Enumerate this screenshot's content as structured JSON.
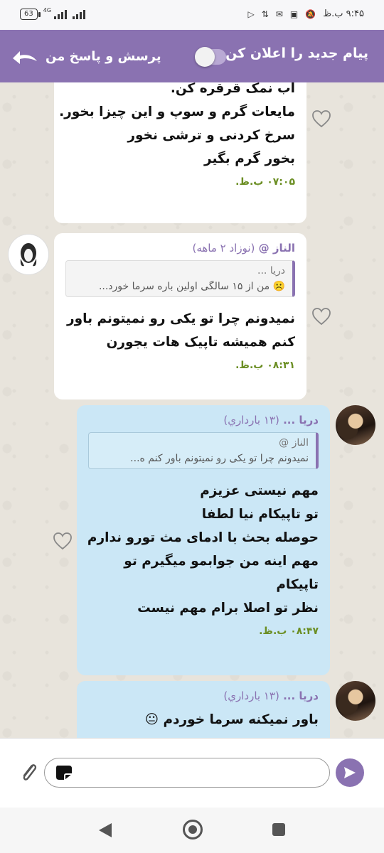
{
  "status_bar": {
    "time": "۹:۴۵ ب.ظ",
    "battery": "63",
    "network": "4G"
  },
  "header": {
    "title": "پیام جدید را اعلان کن",
    "toggle_on": false,
    "qa_label": "پرسش و پاسخ من"
  },
  "messages": [
    {
      "lines": [
        "آب نمک قرقره کن.",
        "مایعات گرم و سوپ و این چیزا بخور.",
        "سرخ کردنی و ترشی نخور",
        "بخور گرم بگیر"
      ],
      "time": "۰۷:۰۵ ب.ظ."
    },
    {
      "sender": "الناز @",
      "sender_note": "(نوزاد ۲ ماهه)",
      "quote_name": "دریا ...",
      "quote_text": "☹️ من از ۱۵ سالگی اولین باره سرما خورد...",
      "lines": [
        "نمیدونم چرا تو یکی رو نمیتونم باور",
        "کنم همیشه تاپیک هات یجورن"
      ],
      "time": "۰۸:۳۱ ب.ظ."
    },
    {
      "sender": "دریا ...",
      "sender_note": "(۱۳ بارداري)",
      "quote_name": "الناز @",
      "quote_text": "نمیدونم چرا تو یکی رو نمیتونم باور کنم ه...",
      "lines": [
        "مهم نیستی عزیزم",
        "تو تاپیکام نیا لطفا",
        "حوصله بحث با ادمای مث تورو ندارم",
        "مهم اینه من جوابمو میگیرم تو",
        "تاپیکام",
        "نظر تو اصلا برام مهم نیست"
      ],
      "time": "۰۸:۴۷ ب.ظ."
    },
    {
      "sender": "دریا ...",
      "sender_note": "(۱۳ بارداري)",
      "lines": [
        "باور نمیکنه سرما خوردم 😐"
      ]
    }
  ],
  "colors": {
    "header": "#8a72b1",
    "time_text": "#6b8e23",
    "incoming_bubble": "#ffffff",
    "outgoing_bubble": "#cbe7f6"
  },
  "icons": {
    "back": "back-arrow-icon",
    "heart": "heart-outline-icon",
    "attach": "paperclip-icon",
    "send": "send-icon"
  }
}
